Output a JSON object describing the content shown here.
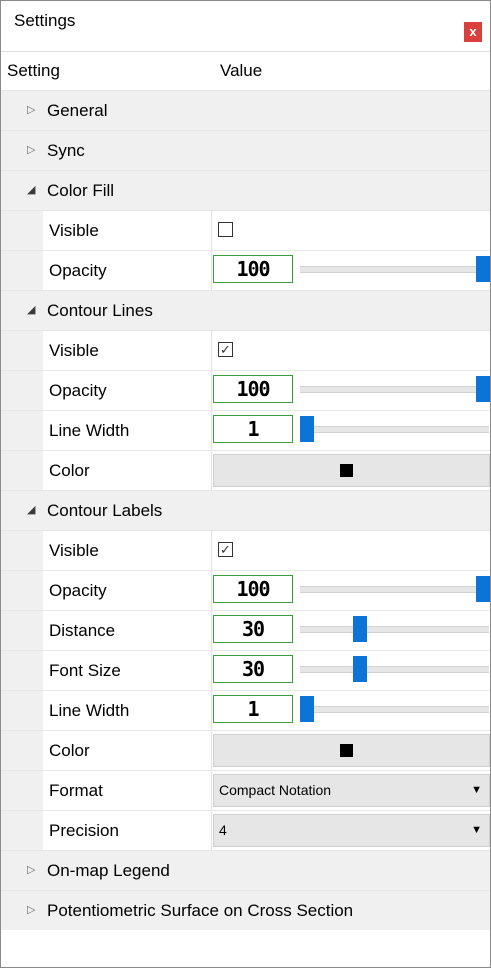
{
  "window": {
    "title": "Settings",
    "close_label": "x"
  },
  "grid": {
    "header_setting": "Setting",
    "header_value": "Value"
  },
  "categories": {
    "general": "General",
    "sync": "Sync",
    "color_fill": "Color Fill",
    "contour_lines": "Contour Lines",
    "contour_labels": "Contour Labels",
    "legend": "On-map Legend",
    "cross_section": "Potentiometric Surface on Cross Section"
  },
  "color_fill": {
    "visible_label": "Visible",
    "visible": false,
    "opacity_label": "Opacity",
    "opacity_value": "100",
    "opacity_fraction": 1.0
  },
  "contour_lines": {
    "visible_label": "Visible",
    "visible": true,
    "opacity_label": "Opacity",
    "opacity_value": "100",
    "opacity_fraction": 1.0,
    "line_width_label": "Line Width",
    "line_width_value": "1",
    "line_width_fraction": 0.0,
    "color_label": "Color",
    "color": "#000000"
  },
  "contour_labels": {
    "visible_label": "Visible",
    "visible": true,
    "opacity_label": "Opacity",
    "opacity_value": "100",
    "opacity_fraction": 1.0,
    "distance_label": "Distance",
    "distance_value": "30",
    "distance_fraction": 0.3,
    "font_size_label": "Font Size",
    "font_size_value": "30",
    "font_size_fraction": 0.3,
    "line_width_label": "Line Width",
    "line_width_value": "1",
    "line_width_fraction": 0.0,
    "color_label": "Color",
    "color": "#000000",
    "format_label": "Format",
    "format_value": "Compact Notation",
    "precision_label": "Precision",
    "precision_value": "4"
  },
  "icons": {
    "collapsed": "▷",
    "expanded": "◢",
    "checkmark": "✓",
    "dropdown": "▼"
  },
  "colors": {
    "accent": "#0c74d6",
    "input_border": "#3c9b3c",
    "close_bg": "#d9403c"
  }
}
